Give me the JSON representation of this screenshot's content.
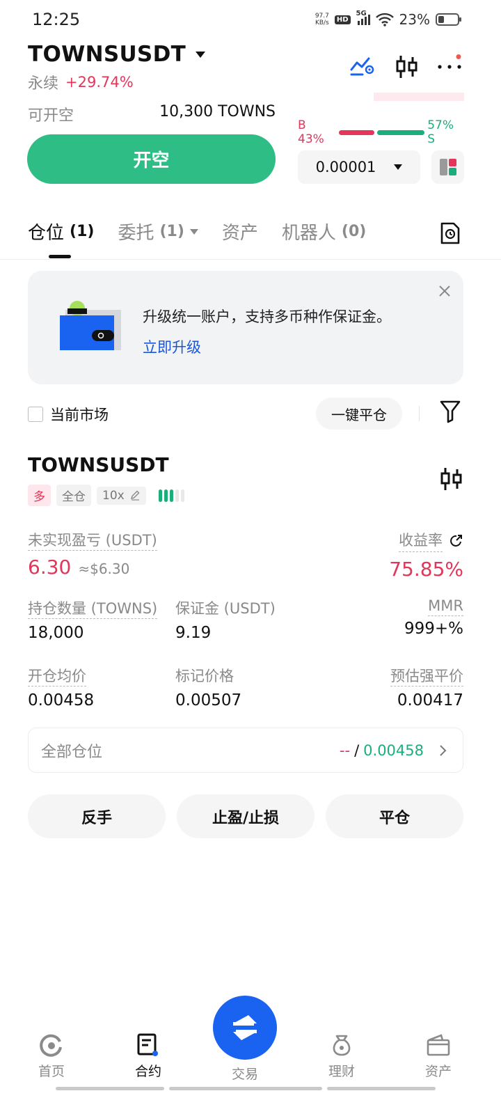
{
  "status_bar": {
    "time": "12:25",
    "net_speed_value": "97.7",
    "net_speed_unit": "KB/s",
    "hd": "HD",
    "signal": "5G",
    "battery": "23%"
  },
  "header": {
    "pair": "TOWNSUSDT",
    "contract_type": "永续",
    "change": "+29.74%"
  },
  "order": {
    "available_label": "可开空",
    "available_value": "10,300 TOWNS",
    "open_button": "开空",
    "buy_ratio": "B 43%",
    "sell_ratio": "57% S",
    "buy_fraction": 0.43,
    "sell_fraction": 0.57,
    "tick_size": "0.00001"
  },
  "tabs": [
    {
      "label": "仓位",
      "count": "(1)"
    },
    {
      "label": "委托",
      "count": "(1)"
    },
    {
      "label": "资产",
      "count": ""
    },
    {
      "label": "机器人",
      "count": "(0)"
    }
  ],
  "banner": {
    "text": "升级统一账户，支持多币种作保证金。",
    "link": "立即升级"
  },
  "filter": {
    "current_market": "当前市场",
    "close_all": "一键平仓"
  },
  "position": {
    "symbol": "TOWNSUSDT",
    "side_tag": "多",
    "margin_mode": "全仓",
    "leverage": "10x",
    "leverage_level": 3,
    "unrealized_label": "未实现盈亏 (USDT)",
    "unrealized_value": "6.30",
    "unrealized_usd": "≈$6.30",
    "roe_label": "收益率",
    "roe_value": "75.85%",
    "size_label": "持仓数量 (TOWNS)",
    "size_value": "18,000",
    "margin_label": "保证金 (USDT)",
    "margin_value": "9.19",
    "mmr_label": "MMR",
    "mmr_value": "999+%",
    "entry_label": "开仓均价",
    "entry_value": "0.00458",
    "mark_label": "标记价格",
    "mark_value": "0.00507",
    "liq_label": "预估强平价",
    "liq_value": "0.00417"
  },
  "all_positions": {
    "label": "全部仓位",
    "left_value": "--",
    "separator": "/",
    "right_value": "0.00458"
  },
  "actions": {
    "reverse": "反手",
    "tpsl": "止盈/止损",
    "close": "平仓"
  },
  "bottom_nav": [
    {
      "label": "首页",
      "icon": "home-icon"
    },
    {
      "label": "合约",
      "icon": "futures-icon"
    },
    {
      "label": "交易",
      "icon": "swap-icon"
    },
    {
      "label": "理财",
      "icon": "earn-icon"
    },
    {
      "label": "资产",
      "icon": "wallet-icon"
    }
  ],
  "colors": {
    "green": "#2dbd85",
    "red": "#e2365a",
    "blue": "#1a62f0",
    "orange": "#f0a045"
  }
}
